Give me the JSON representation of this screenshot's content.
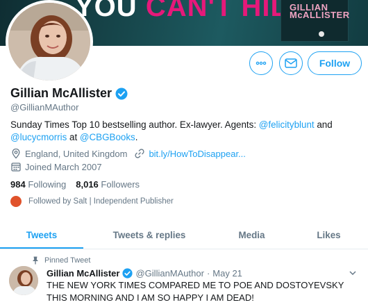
{
  "banner": {
    "word1": "YOU",
    "word2": "CAN'T HIDE",
    "word3": "?",
    "book_title": "GILLIAN\nMcALLISTER"
  },
  "actions": {
    "follow_label": "Follow"
  },
  "profile": {
    "name": "Gillian McAllister",
    "handle": "@GillianMAuthor",
    "bio_prefix": "Sunday Times Top 10 bestselling author. Ex-lawyer. Agents: ",
    "bio_link1": "@felicityblunt",
    "bio_and": " and",
    "bio_link2": "@lucycmorris",
    "bio_at": " at ",
    "bio_link3": "@CBGBooks",
    "bio_end": ".",
    "location": "England, United Kingdom",
    "website": "bit.ly/HowToDisappear...",
    "joined": "Joined March 2007"
  },
  "stats": {
    "following_count": "984",
    "following_label": "Following",
    "followers_count": "8,016",
    "followers_label": "Followers"
  },
  "followed_by": "Followed by Salt | Independent Publisher",
  "tabs": [
    {
      "label": "Tweets"
    },
    {
      "label": "Tweets & replies"
    },
    {
      "label": "Media"
    },
    {
      "label": "Likes"
    }
  ],
  "tweet": {
    "pinned_label": "Pinned Tweet",
    "author": "Gillian McAllister",
    "handle": "@GillianMAuthor",
    "separator": "·",
    "date": "May 21",
    "text": "THE NEW YORK TIMES COMPARED ME TO POE AND DOSTOYEVSKY THIS MORNING AND I AM SO HAPPY I AM DEAD!"
  },
  "colors": {
    "accent": "#1da1f2",
    "banner_pink": "#e6197a",
    "muted": "#657786"
  }
}
